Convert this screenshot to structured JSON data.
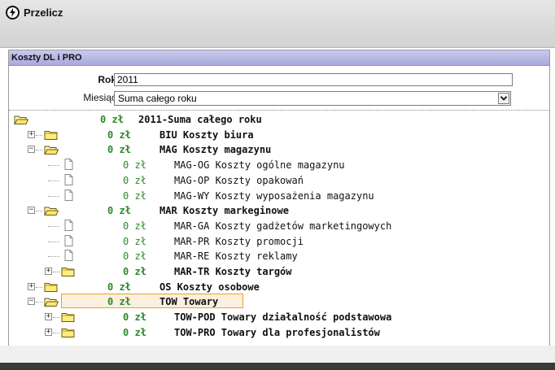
{
  "toolbar": {
    "przelicz_label": "Przelicz"
  },
  "panel": {
    "title": "Koszty DL i PRO"
  },
  "filters": {
    "rok_label": "Rok",
    "rok_value": "2011",
    "miesiac_label": "Miesiąc",
    "miesiac_value": "Suma całego roku"
  },
  "tree": [
    {
      "amount": "0 zł",
      "code": "2011-Suma całego roku",
      "level": 0,
      "type": "folder-open",
      "bold": true,
      "expander": "none"
    },
    {
      "amount": "0 zł",
      "code": "BIU Koszty biura",
      "level": 1,
      "type": "folder",
      "bold": true,
      "expander": "+"
    },
    {
      "amount": "0 zł",
      "code": "MAG Koszty magazynu",
      "level": 1,
      "type": "folder-open",
      "bold": true,
      "expander": "-"
    },
    {
      "amount": "0 zł",
      "code": "MAG-OG Koszty ogólne magazynu",
      "level": 2,
      "type": "doc",
      "bold": false,
      "expander": "none"
    },
    {
      "amount": "0 zł",
      "code": "MAG-OP Koszty opakowań",
      "level": 2,
      "type": "doc",
      "bold": false,
      "expander": "none"
    },
    {
      "amount": "0 zł",
      "code": "MAG-WY Koszty wyposażenia magazynu",
      "level": 2,
      "type": "doc",
      "bold": false,
      "expander": "none"
    },
    {
      "amount": "0 zł",
      "code": "MAR Koszty markeginowe",
      "level": 1,
      "type": "folder-open",
      "bold": true,
      "expander": "-"
    },
    {
      "amount": "0 zł",
      "code": "MAR-GA Koszty gadżetów marketingowych",
      "level": 2,
      "type": "doc",
      "bold": false,
      "expander": "none"
    },
    {
      "amount": "0 zł",
      "code": "MAR-PR Koszty promocji",
      "level": 2,
      "type": "doc",
      "bold": false,
      "expander": "none"
    },
    {
      "amount": "0 zł",
      "code": "MAR-RE Koszty reklamy",
      "level": 2,
      "type": "doc",
      "bold": false,
      "expander": "none"
    },
    {
      "amount": "0 zł",
      "code": "MAR-TR Koszty targów",
      "level": 2,
      "type": "folder",
      "bold": true,
      "expander": "+"
    },
    {
      "amount": "0 zł",
      "code": "OS Koszty osobowe",
      "level": 1,
      "type": "folder",
      "bold": true,
      "expander": "+"
    },
    {
      "amount": "0 zł",
      "code": "TOW Towary",
      "level": 1,
      "type": "folder-open",
      "bold": true,
      "expander": "-",
      "selected": true
    },
    {
      "amount": "0 zł",
      "code": "TOW-POD Towary działalność podstawowa",
      "level": 2,
      "type": "folder",
      "bold": true,
      "expander": "+"
    },
    {
      "amount": "0 zł",
      "code": "TOW-PRO Towary dla profesjonalistów",
      "level": 2,
      "type": "folder",
      "bold": true,
      "expander": "+"
    }
  ]
}
